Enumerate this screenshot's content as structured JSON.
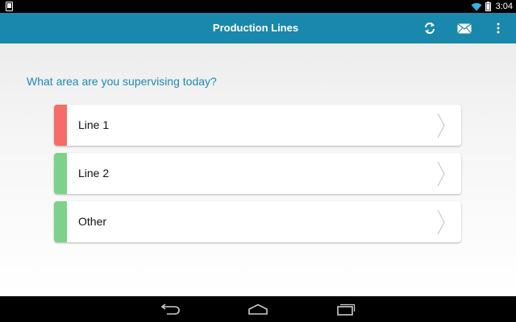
{
  "status_bar": {
    "time": "3:04",
    "icons": [
      "screenshot-phone-icon",
      "wifi-icon",
      "battery-icon"
    ]
  },
  "action_bar": {
    "title": "Production Lines",
    "actions": [
      "refresh-icon",
      "mail-icon",
      "overflow-menu-icon"
    ],
    "background_color": "#1a87ad"
  },
  "main": {
    "prompt": "What area are you supervising today?",
    "prompt_color": "#1a8ab3",
    "options": [
      {
        "label": "Line 1",
        "status_color": "#f46d6a"
      },
      {
        "label": "Line 2",
        "status_color": "#7dd18c"
      },
      {
        "label": "Other",
        "status_color": "#7dd18c"
      }
    ]
  },
  "nav_bar": {
    "buttons": [
      "back-icon",
      "home-icon",
      "recent-apps-icon"
    ]
  }
}
